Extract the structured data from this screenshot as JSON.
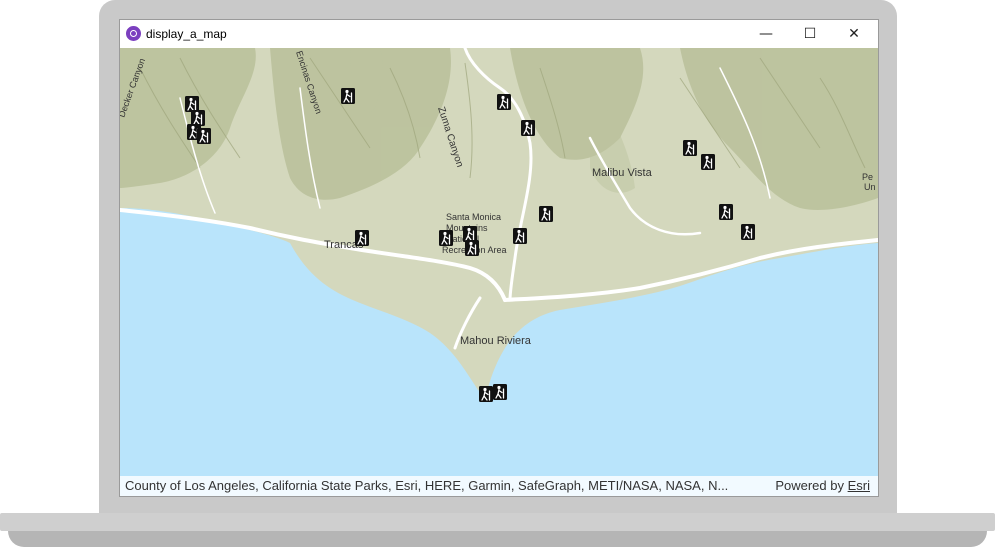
{
  "window": {
    "title": "display_a_map",
    "minimize_glyph": "—",
    "maximize_glyph": "☐",
    "close_glyph": "✕"
  },
  "map": {
    "place_labels": [
      "Malibu Vista",
      "Trancas",
      "Mahou Riviera",
      "Santa Monica",
      "Mountains",
      "National",
      "Recreation Area"
    ],
    "road_labels": [
      "Zuma Canyon",
      "Decker Canyon",
      "Encinas Canyon"
    ],
    "edge_labels": [
      "Pe",
      "Un"
    ],
    "trailhead_icon": "hiker-icon",
    "colors": {
      "water": "#b9e4fb",
      "land": "#d4d8bd",
      "hills": "#b6bd96",
      "roads": "#ffffff"
    }
  },
  "attribution": {
    "text": "County of Los Angeles, California State Parks, Esri, HERE, Garmin, SafeGraph, METI/NASA, NASA, N...",
    "powered_by": "Powered by",
    "esri_link": "Esri"
  }
}
